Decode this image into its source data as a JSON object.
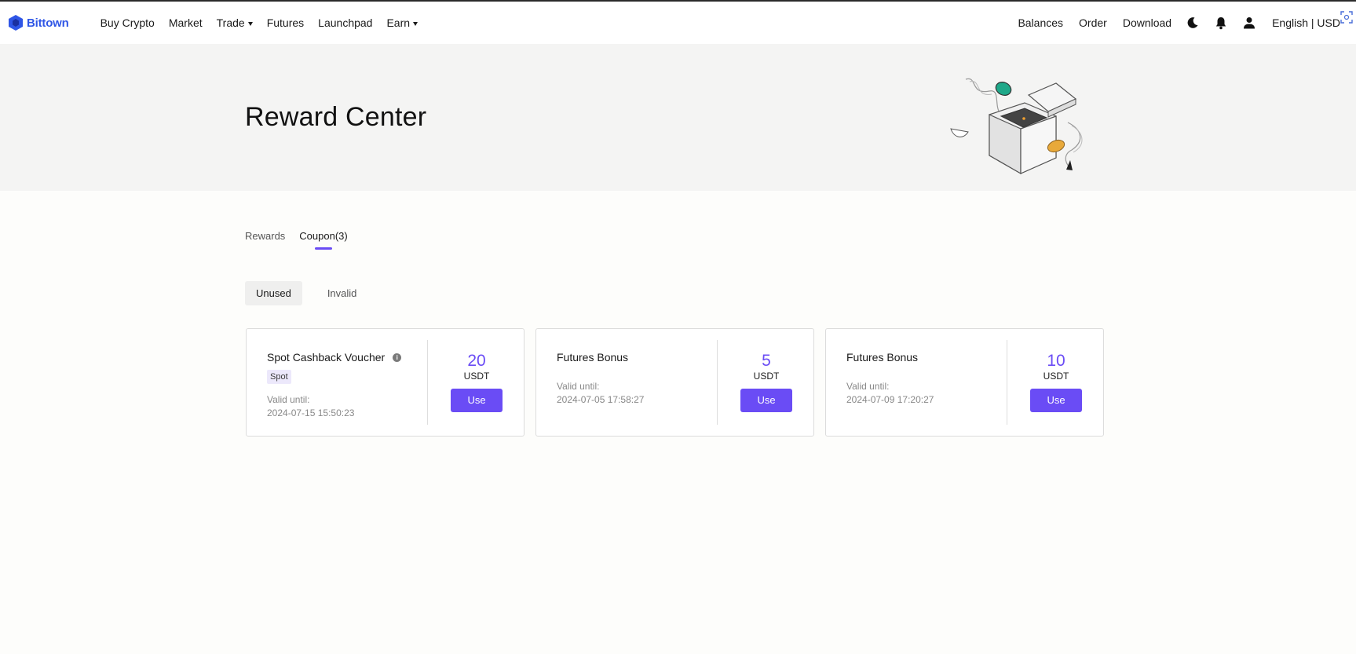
{
  "brand": {
    "name": "Bittown",
    "color": "#2f56e6",
    "accent": "#6a4cf5"
  },
  "nav": {
    "items": [
      {
        "label": "Buy Crypto",
        "dropdown": false
      },
      {
        "label": "Market",
        "dropdown": false
      },
      {
        "label": "Trade",
        "dropdown": true
      },
      {
        "label": "Futures",
        "dropdown": false
      },
      {
        "label": "Launchpad",
        "dropdown": false
      },
      {
        "label": "Earn",
        "dropdown": true
      }
    ],
    "right": {
      "balances": "Balances",
      "order": "Order",
      "download": "Download",
      "language": "English | USD"
    },
    "icons": [
      "moon-icon",
      "bell-icon",
      "user-icon",
      "scan-icon"
    ]
  },
  "banner": {
    "title": "Reward Center"
  },
  "tabs": [
    {
      "label": "Rewards",
      "active": false
    },
    {
      "label": "Coupon(3)",
      "active": true
    }
  ],
  "subtabs": [
    {
      "label": "Unused",
      "active": true
    },
    {
      "label": "Invalid",
      "active": false
    }
  ],
  "coupons": [
    {
      "title": "Spot Cashback Voucher",
      "has_info": true,
      "tag": "Spot",
      "valid_label": "Valid until:",
      "valid_until": "2024-07-15 15:50:23",
      "amount": "20",
      "unit": "USDT",
      "button": "Use"
    },
    {
      "title": "Futures Bonus",
      "has_info": false,
      "tag": "",
      "valid_label": "Valid until:",
      "valid_until": "2024-07-05 17:58:27",
      "amount": "5",
      "unit": "USDT",
      "button": "Use"
    },
    {
      "title": "Futures Bonus",
      "has_info": false,
      "tag": "",
      "valid_label": "Valid until:",
      "valid_until": "2024-07-09 17:20:27",
      "amount": "10",
      "unit": "USDT",
      "button": "Use"
    }
  ]
}
